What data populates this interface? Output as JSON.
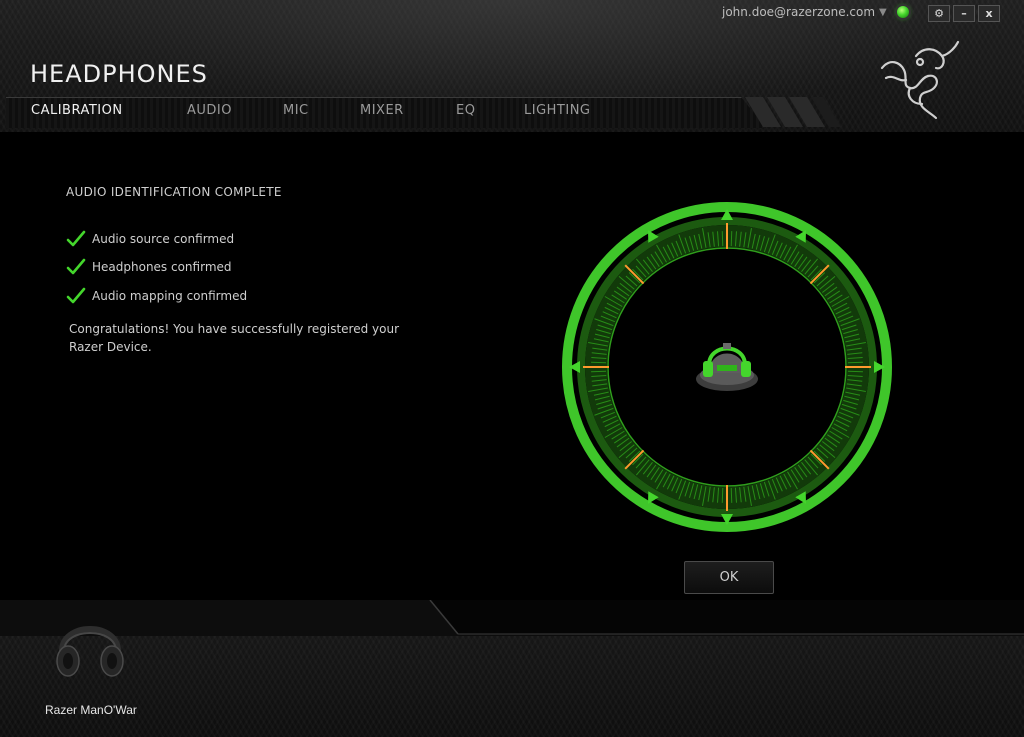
{
  "account": {
    "email": "john.doe@razerzone.com"
  },
  "window_buttons": {
    "settings": "⚙",
    "minimize": "–",
    "close": "x"
  },
  "app": {
    "title": "HEADPHONES"
  },
  "tabs": [
    {
      "label": "CALIBRATION",
      "active": true
    },
    {
      "label": "AUDIO",
      "active": false
    },
    {
      "label": "MIC",
      "active": false
    },
    {
      "label": "MIXER",
      "active": false
    },
    {
      "label": "EQ",
      "active": false
    },
    {
      "label": "LIGHTING",
      "active": false
    }
  ],
  "calibration": {
    "title": "AUDIO IDENTIFICATION COMPLETE",
    "checks": [
      "Audio source confirmed",
      "Headphones confirmed",
      "Audio mapping confirmed"
    ],
    "message": "Congratulations! You have successfully registered your Razer Device.",
    "ok_label": "OK"
  },
  "device": {
    "name": "Razer ManO'War"
  },
  "icons": {
    "logo": "razer-logo",
    "check": "check-icon",
    "dial": "surround-calibration-dial",
    "headset": "headset-icon",
    "user": "user-head-icon"
  },
  "colors": {
    "accent": "#44d62c",
    "accent_dark": "#1e7a12",
    "marker": "#ff9a2e",
    "background": "#000000"
  }
}
